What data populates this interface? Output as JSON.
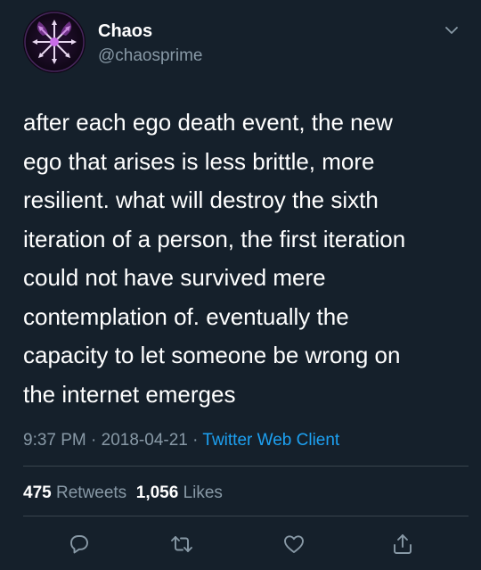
{
  "author": {
    "name": "Chaos",
    "handle": "@chaosprime"
  },
  "tweet": {
    "lines": [
      "after each ego death event, the new",
      "ego that arises is less brittle, more",
      "resilient.  what will destroy the sixth",
      "iteration of a person, the first iteration",
      "could not have survived mere",
      "contemplation of.  eventually the",
      "capacity to let someone be wrong on",
      "the internet emerges"
    ],
    "time": "9:37 PM",
    "separator": " · ",
    "date": "2018-04-21",
    "source": "Twitter Web Client"
  },
  "stats": {
    "retweets_count": "475",
    "retweets_label": "Retweets",
    "likes_count": "1,056",
    "likes_label": "Likes"
  },
  "icons": {
    "menu": "chevron-down-icon",
    "reply": "reply-icon",
    "retweet": "retweet-icon",
    "like": "like-icon",
    "share": "share-icon"
  },
  "colors": {
    "background": "#15202b",
    "text": "#ffffff",
    "secondary_text": "#8899a6",
    "link": "#1da1f2",
    "divider": "#38444d"
  }
}
